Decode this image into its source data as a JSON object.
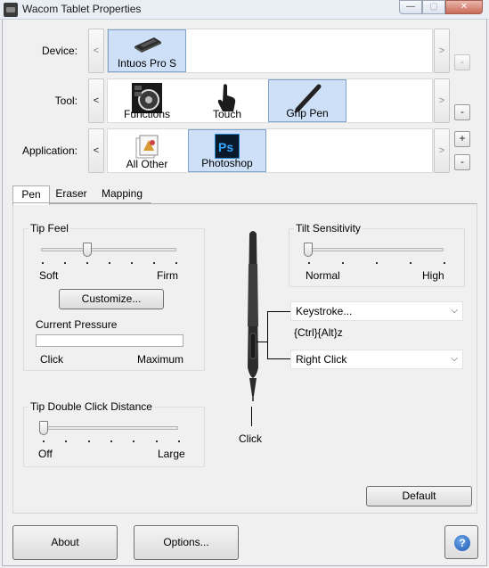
{
  "window": {
    "title": "Wacom Tablet Properties",
    "min_glyph": "—",
    "max_glyph": "▢",
    "close_glyph": "✕"
  },
  "device": {
    "label": "Device:",
    "items": [
      {
        "label": "Intuos Pro S",
        "selected": true,
        "icon": "tablet-icon"
      }
    ],
    "prev": "<",
    "next": ">",
    "remove": "-"
  },
  "tool": {
    "label": "Tool:",
    "items": [
      {
        "label": "Functions",
        "selected": false,
        "icon": "functions-icon"
      },
      {
        "label": "Touch",
        "selected": false,
        "icon": "touch-hand-icon"
      },
      {
        "label": "Grip Pen",
        "selected": true,
        "icon": "grip-pen-icon"
      }
    ],
    "prev": "<",
    "next": ">",
    "remove": "-"
  },
  "application": {
    "label": "Application:",
    "items": [
      {
        "label": "All Other",
        "selected": false,
        "icon": "all-other-apps-icon"
      },
      {
        "label": "Photoshop",
        "selected": true,
        "icon": "photoshop-icon"
      }
    ],
    "prev": "<",
    "next": ">",
    "add": "+",
    "remove": "-"
  },
  "tabs": [
    {
      "label": "Pen",
      "active": true
    },
    {
      "label": "Eraser",
      "active": false
    },
    {
      "label": "Mapping",
      "active": false
    }
  ],
  "pen": {
    "tip_feel": {
      "title": "Tip Feel",
      "min_label": "Soft",
      "max_label": "Firm",
      "value_fraction": 0.33,
      "customize_label": "Customize..."
    },
    "current_pressure": {
      "title": "Current Pressure",
      "min_label": "Click",
      "max_label": "Maximum",
      "value_fraction": 0
    },
    "tip_double_click": {
      "title": "Tip Double Click Distance",
      "min_label": "Off",
      "max_label": "Large",
      "value_fraction": 0.0
    },
    "tilt_sensitivity": {
      "title": "Tilt Sensitivity",
      "min_label": "Normal",
      "max_label": "High",
      "value_fraction": 0.0
    },
    "upper_button": {
      "value": "Keystroke...",
      "detail": "{Ctrl}{Alt}z"
    },
    "lower_button": {
      "value": "Right Click"
    },
    "tip_action": "Click",
    "default_label": "Default"
  },
  "footer": {
    "about_label": "About",
    "options_label": "Options...",
    "help_glyph": "?"
  }
}
